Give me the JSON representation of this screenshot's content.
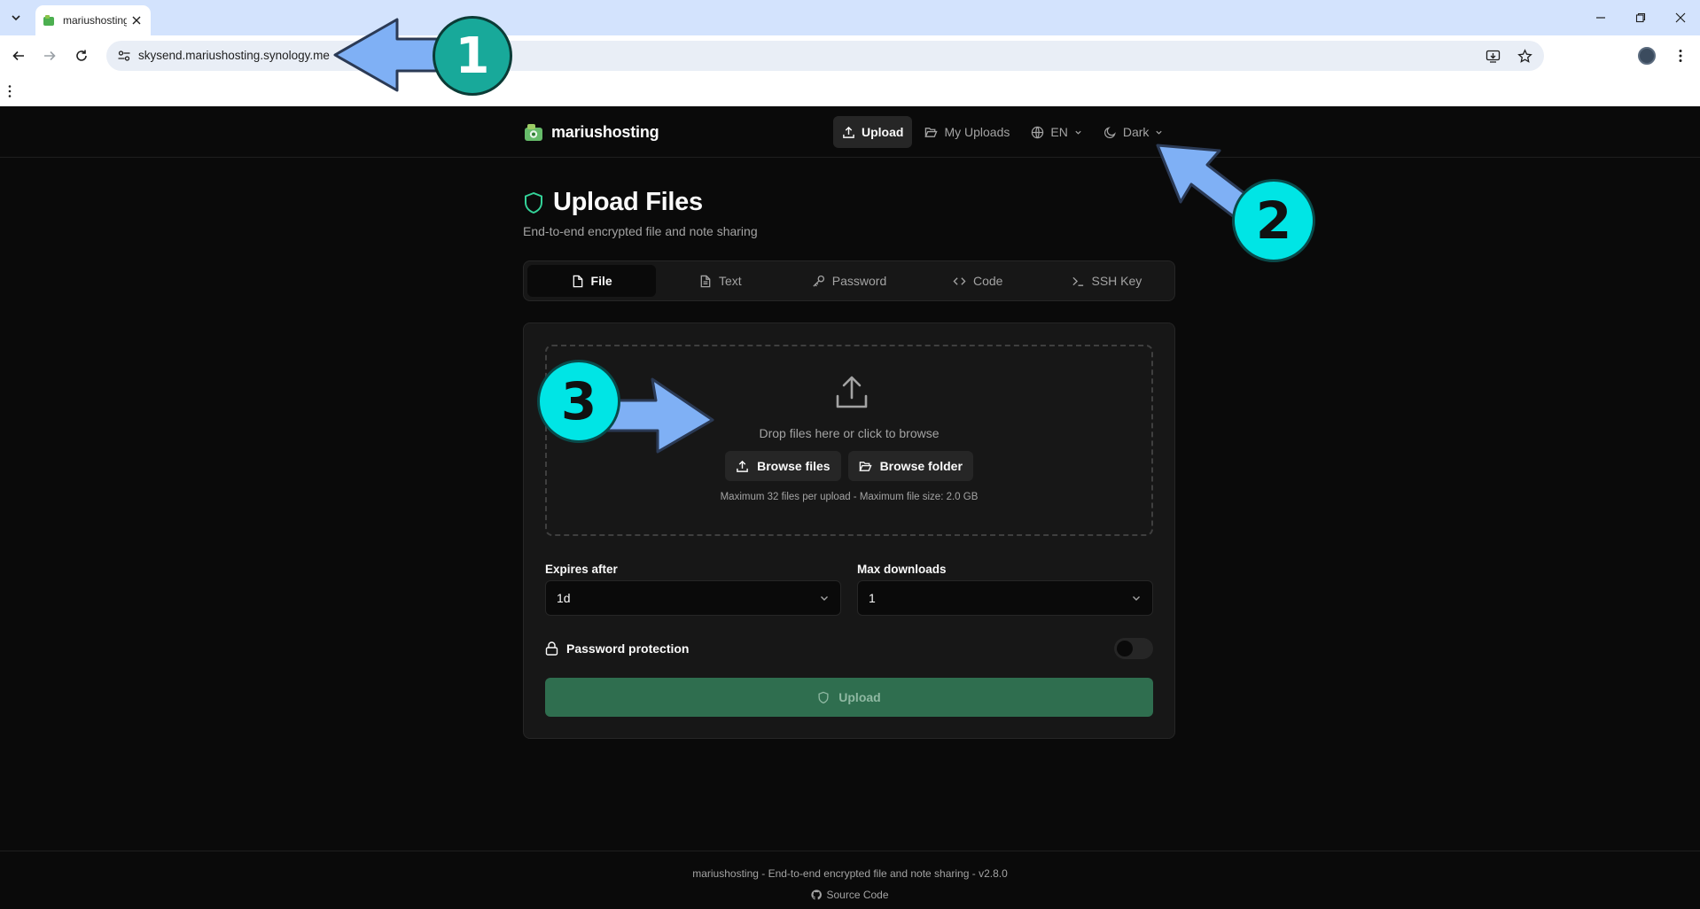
{
  "browser": {
    "tab_title": "mariushosting",
    "url": "skysend.mariushosting.synology.me"
  },
  "header": {
    "brand_name": "mariushosting",
    "nav": {
      "upload": "Upload",
      "my_uploads": "My Uploads",
      "language": "EN",
      "theme": "Dark"
    }
  },
  "main": {
    "title": "Upload Files",
    "subtitle": "End-to-end encrypted file and note sharing",
    "tabs": [
      {
        "label": "File",
        "icon": "file-icon",
        "active": true
      },
      {
        "label": "Text",
        "icon": "file-text-icon",
        "active": false
      },
      {
        "label": "Password",
        "icon": "key-icon",
        "active": false
      },
      {
        "label": "Code",
        "icon": "code-icon",
        "active": false
      },
      {
        "label": "SSH Key",
        "icon": "terminal-icon",
        "active": false
      }
    ],
    "dropzone": {
      "text": "Drop files here or click to browse",
      "browse_files": "Browse files",
      "browse_folder": "Browse folder",
      "note": "Maximum 32 files per upload - Maximum file size: 2.0 GB"
    },
    "expires": {
      "label": "Expires after",
      "value": "1d"
    },
    "max_downloads": {
      "label": "Max downloads",
      "value": "1"
    },
    "password_protection": {
      "label": "Password protection",
      "enabled": false
    },
    "upload_button": "Upload"
  },
  "footer": {
    "text": "mariushosting - End-to-end encrypted file and note sharing - v2.8.0",
    "source_link": "Source Code"
  },
  "annotations": {
    "badge_1": "1",
    "badge_2": "2",
    "badge_3": "3"
  },
  "colors": {
    "accent": "#2f6e4f",
    "shield": "#34d399",
    "badge": "#00e5e5",
    "arrow": "#7fb0f5"
  }
}
